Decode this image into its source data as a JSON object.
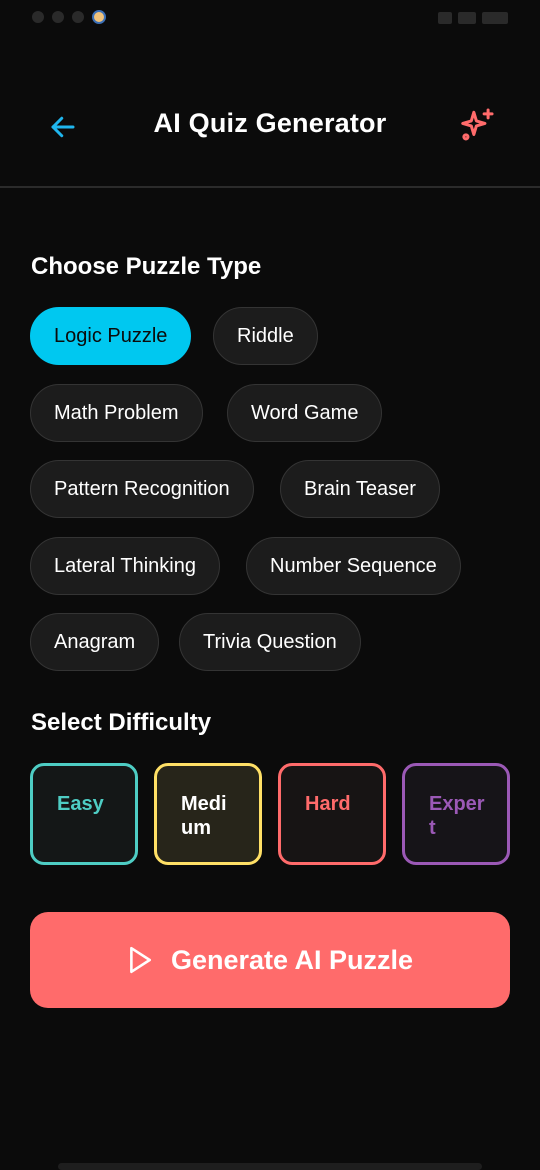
{
  "header": {
    "title": "AI Quiz Generator",
    "back_icon": "arrow-left-icon",
    "action_icon": "sparkles-icon",
    "back_color": "#1fb6ee",
    "action_color": "#ff6b6b"
  },
  "puzzle_section": {
    "title": "Choose Puzzle Type",
    "selected": "Logic Puzzle",
    "types": [
      {
        "label": "Logic Puzzle"
      },
      {
        "label": "Riddle"
      },
      {
        "label": "Math Problem"
      },
      {
        "label": "Word Game"
      },
      {
        "label": "Pattern Recognition"
      },
      {
        "label": "Brain Teaser"
      },
      {
        "label": "Lateral Thinking"
      },
      {
        "label": "Number Sequence"
      },
      {
        "label": "Anagram"
      },
      {
        "label": "Trivia Question"
      }
    ]
  },
  "difficulty_section": {
    "title": "Select Difficulty",
    "levels": [
      {
        "label": "Easy",
        "color": "#4ecdc4"
      },
      {
        "label": "Medium",
        "color": "#ffe066"
      },
      {
        "label": "Hard",
        "color": "#ff6b6b"
      },
      {
        "label": "Expert",
        "color": "#9b59b6"
      }
    ]
  },
  "generate_button": {
    "label": "Generate AI Puzzle",
    "icon": "play-icon",
    "color": "#ff6b6b"
  },
  "colors": {
    "background": "#0b0b0b",
    "chip_selected": "#00c8f0",
    "chip_bg": "#1c1c1c"
  }
}
